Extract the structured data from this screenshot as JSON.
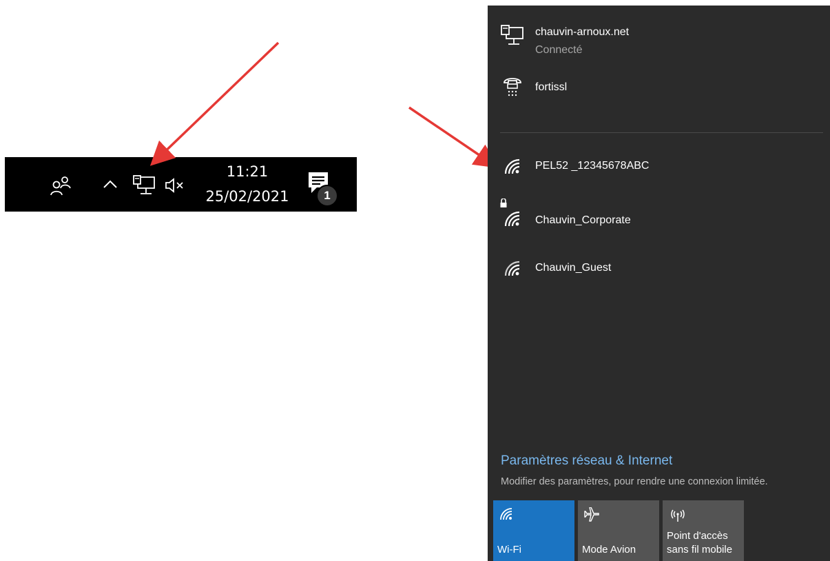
{
  "taskbar": {
    "time": "11:21",
    "date": "25/02/2021",
    "notification_count": "1",
    "icons": [
      "people-icon",
      "chevron-up-icon",
      "network-wired-icon",
      "volume-muted-icon",
      "action-center-icon"
    ]
  },
  "flyout": {
    "connections": [
      {
        "name": "chauvin-arnoux.net",
        "status": "Connecté",
        "icon": "ethernet-icon"
      },
      {
        "name": "fortissl",
        "icon": "dialup-icon"
      }
    ],
    "wifi_networks": [
      {
        "name": "PEL52 _12345678ABC",
        "icon": "wifi-icon"
      },
      {
        "name": "Chauvin_Corporate",
        "icon": "wifi-secured-icon",
        "secured": true
      },
      {
        "name": "Chauvin_Guest",
        "icon": "wifi-icon"
      }
    ],
    "settings_link": "Paramètres réseau & Internet",
    "settings_desc": "Modifier des paramètres, pour rendre une connexion limitée.",
    "quick_actions": [
      {
        "label": "Wi-Fi",
        "icon": "wifi-icon",
        "active": true
      },
      {
        "label": "Mode Avion",
        "icon": "airplane-icon",
        "active": false
      },
      {
        "label_line1": "Point d'accès",
        "label_line2": "sans fil mobile",
        "icon": "hotspot-icon",
        "active": false
      }
    ]
  },
  "colors": {
    "taskbar_bg": "#000000",
    "flyout_bg": "#2b2b2b",
    "accent": "#1b74c2",
    "link": "#7ab8ee",
    "arrow": "#e53935"
  }
}
